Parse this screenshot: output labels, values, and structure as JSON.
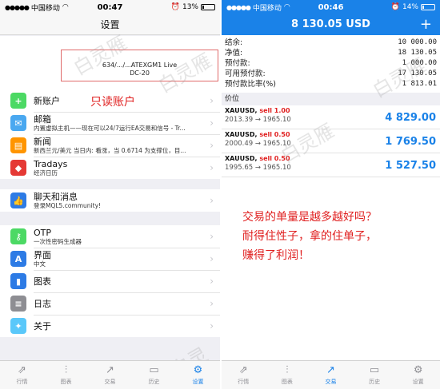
{
  "left": {
    "status": {
      "carrier": "中国移动",
      "time": "00:47",
      "battery": "13%",
      "battery_level": 0.13
    },
    "nav_title": "设置",
    "account": {
      "line1": "634/.../...ATEXGM1 Live",
      "line2": "DC-20"
    },
    "readonly_note": "只读账户",
    "menu_group1": [
      {
        "icon": "add-user-icon",
        "color": "#4cd964",
        "title": "新账户",
        "subtitle": ""
      },
      {
        "icon": "mail-icon",
        "color": "#4aa8f0",
        "title": "邮箱",
        "subtitle": "内置虚拟主机——现在可以24/7运行EA交易和信号 - Tr..."
      },
      {
        "icon": "news-book-icon",
        "color": "#ff9500",
        "title": "新闻",
        "subtitle": "新西兰元/美元 当日内: 看涨，当 0.6714 为支撑位，目..."
      },
      {
        "icon": "calendar-icon",
        "color": "#e53935",
        "title": "Tradays",
        "subtitle": "经济日历"
      }
    ],
    "menu_group2": [
      {
        "icon": "chat-thumb-icon",
        "color": "#2d7be5",
        "title": "聊天和消息",
        "subtitle": "登录MQL5.community!"
      }
    ],
    "menu_group3": [
      {
        "icon": "otp-key-icon",
        "color": "#4cd964",
        "title": "OTP",
        "subtitle": "一次性密码生成器"
      },
      {
        "icon": "language-icon",
        "color": "#2d7be5",
        "title": "界面",
        "subtitle": "中文"
      },
      {
        "icon": "chart-candles-icon",
        "color": "#2d7be5",
        "title": "图表",
        "subtitle": ""
      },
      {
        "icon": "journal-icon",
        "color": "#8e8e93",
        "title": "日志",
        "subtitle": ""
      },
      {
        "icon": "about-icon",
        "color": "#5ac8fa",
        "title": "关于",
        "subtitle": ""
      }
    ],
    "tabs": [
      "行情",
      "图表",
      "交易",
      "历史",
      "设置"
    ],
    "active_tab": 4
  },
  "right": {
    "status": {
      "carrier": "中国移动",
      "time": "00:46",
      "battery": "14%",
      "battery_level": 0.14
    },
    "nav_title": "8 130.05 USD",
    "plus": "+",
    "account_rows": [
      {
        "label": "结余:",
        "value": "10 000.00"
      },
      {
        "label": "净值:",
        "value": "18 130.05"
      },
      {
        "label": "预付款:",
        "value": "1 000.00"
      },
      {
        "label": "可用预付款:",
        "value": "17 130.05"
      },
      {
        "label": "预付款比率(%)",
        "value": "1 813.01"
      }
    ],
    "section": "价位",
    "positions": [
      {
        "symbol": "XAUUSD,",
        "side": "sell 1.00",
        "prices": "2013.39 → 1965.10",
        "profit": "4 829.00"
      },
      {
        "symbol": "XAUUSD,",
        "side": "sell 0.50",
        "prices": "2000.49 → 1965.10",
        "profit": "1 769.50"
      },
      {
        "symbol": "XAUUSD,",
        "side": "sell 0.50",
        "prices": "1995.65 → 1965.10",
        "profit": "1 527.50"
      }
    ],
    "note_lines": [
      "交易的单量是越多越好吗？",
      "耐得住性子，拿的住单子，",
      "赚得了利润！"
    ],
    "tabs": [
      "行情",
      "图表",
      "交易",
      "历史",
      "设置"
    ],
    "active_tab": 2
  },
  "watermark": "白灵雁",
  "tab_icons": [
    "quotes-icon",
    "chart-icon",
    "trade-icon",
    "history-icon",
    "settings-gear-icon"
  ]
}
